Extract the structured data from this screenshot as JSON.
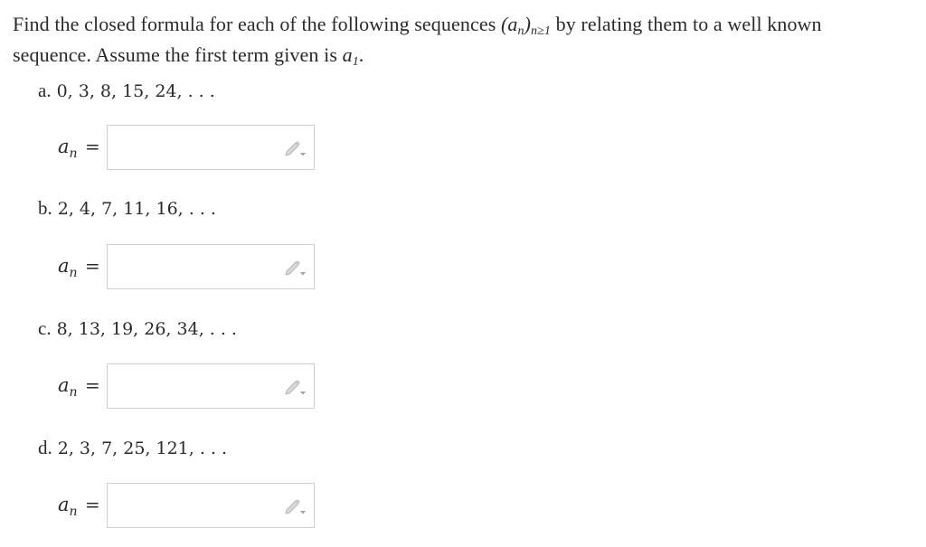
{
  "intro": {
    "line1_pre": "Find the closed formula for each of the following sequences ",
    "seq_symbol": "(a",
    "seq_sub_n": "n",
    "seq_close": ")",
    "seq_index": "n≥1",
    "line1_post": " by relating them to a well known",
    "line2_pre": "sequence. Assume the first term given is ",
    "first_term": "a",
    "first_term_sub": "1",
    "line2_post": "."
  },
  "parts": [
    {
      "letter": "a.",
      "terms": "0, 3, 8, 15, 24, . . ."
    },
    {
      "letter": "b.",
      "terms": "2, 4, 7, 11, 16, . . ."
    },
    {
      "letter": "c.",
      "terms": "8, 13, 19, 26, 34, . . ."
    },
    {
      "letter": "d.",
      "terms": "2, 3, 7, 25, 121, . . ."
    }
  ],
  "answer": {
    "lhs_var": "a",
    "lhs_sub": "n",
    "equals": "=",
    "value_a": "",
    "value_b": "",
    "value_c": "",
    "value_d": ""
  },
  "icons": {
    "edit": "pencil-dropdown-icon"
  }
}
